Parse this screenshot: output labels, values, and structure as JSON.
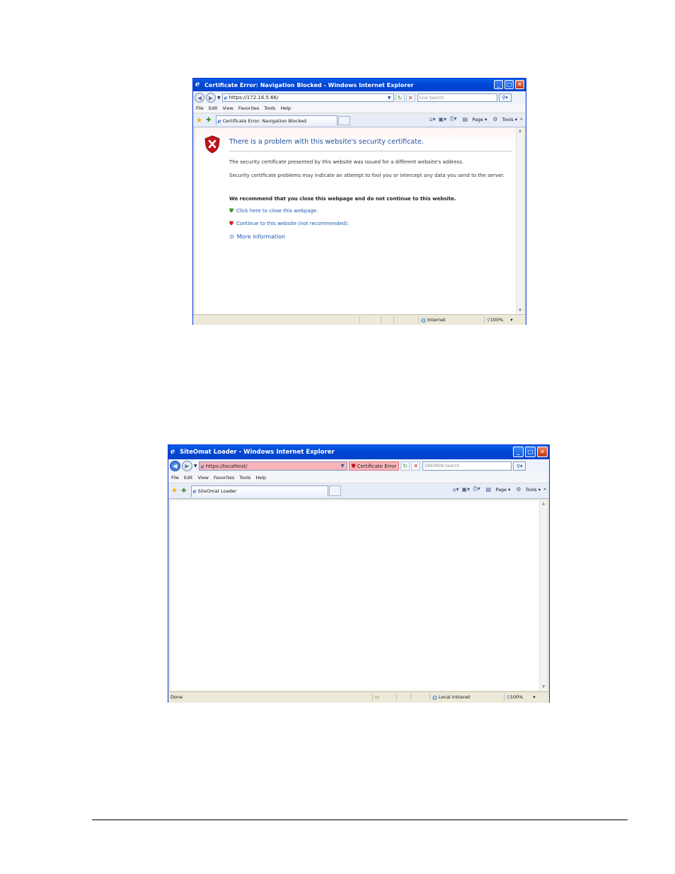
{
  "window1": {
    "title": "Certificate Error: Navigation Blocked - Windows Internet Explorer",
    "address": "https://172.16.5.66/",
    "search_placeholder": "Live Search",
    "menu": [
      "File",
      "Edit",
      "View",
      "Favorites",
      "Tools",
      "Help"
    ],
    "tab_label": "Certificate Error: Navigation Blocked",
    "cmd_page": "Page",
    "cmd_tools": "Tools",
    "error": {
      "title": "There is a problem with this website's security certificate.",
      "p1": "The security certificate presented by this website was issued for a different website's address.",
      "p2": "Security certificate problems may indicate an attempt to fool you or intercept any data you send to the server.",
      "recommend": "We recommend that you close this webpage and do not continue to this website.",
      "close_link": "Click here to close this webpage.",
      "continue_link": "Continue to this website (not recommended).",
      "more_info": "More information"
    },
    "status_zone": "Internet",
    "zoom": "100%"
  },
  "window2": {
    "title": "SiteOmat Loader - Windows Internet Explorer",
    "address": "https://localhost/",
    "cert_error": "Certificate Error",
    "search_placeholder": "DAEMON Search",
    "menu": [
      "File",
      "Edit",
      "View",
      "Favorites",
      "Tools",
      "Help"
    ],
    "tab_label": "SiteOmat Loader",
    "cmd_page": "Page",
    "cmd_tools": "Tools",
    "status_text": "Done",
    "status_zone": "Local intranet",
    "zoom": "100%"
  }
}
